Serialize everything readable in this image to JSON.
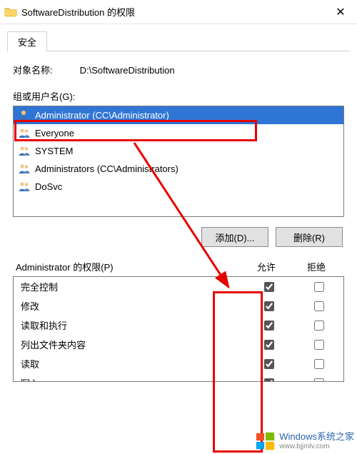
{
  "titlebar": {
    "title": "SoftwareDistribution 的权限",
    "close_glyph": "✕"
  },
  "tabs": {
    "security": "安全"
  },
  "object": {
    "label": "对象名称:",
    "value": "D:\\SoftwareDistribution"
  },
  "group": {
    "label": "组或用户名(G):",
    "users": [
      {
        "name": "Administrator (CC\\Administrator)",
        "selected": true,
        "icon": "user"
      },
      {
        "name": "Everyone",
        "selected": false,
        "icon": "group"
      },
      {
        "name": "SYSTEM",
        "selected": false,
        "icon": "group"
      },
      {
        "name": "Administrators (CC\\Administrators)",
        "selected": false,
        "icon": "group"
      },
      {
        "name": "DoSvc",
        "selected": false,
        "icon": "group"
      }
    ]
  },
  "buttons": {
    "add": "添加(D)...",
    "remove": "删除(R)"
  },
  "perm": {
    "header_label": "Administrator 的权限(P)",
    "col_allow": "允许",
    "col_deny": "拒绝",
    "rows": [
      {
        "name": "完全控制",
        "allow": true,
        "deny": false
      },
      {
        "name": "修改",
        "allow": true,
        "deny": false
      },
      {
        "name": "读取和执行",
        "allow": true,
        "deny": false
      },
      {
        "name": "列出文件夹内容",
        "allow": true,
        "deny": false
      },
      {
        "name": "读取",
        "allow": true,
        "deny": false
      },
      {
        "name": "写入",
        "allow": true,
        "deny": false
      }
    ]
  },
  "watermark": {
    "zh": "Windows系统之家",
    "en": "www.bjjmlv.com"
  }
}
